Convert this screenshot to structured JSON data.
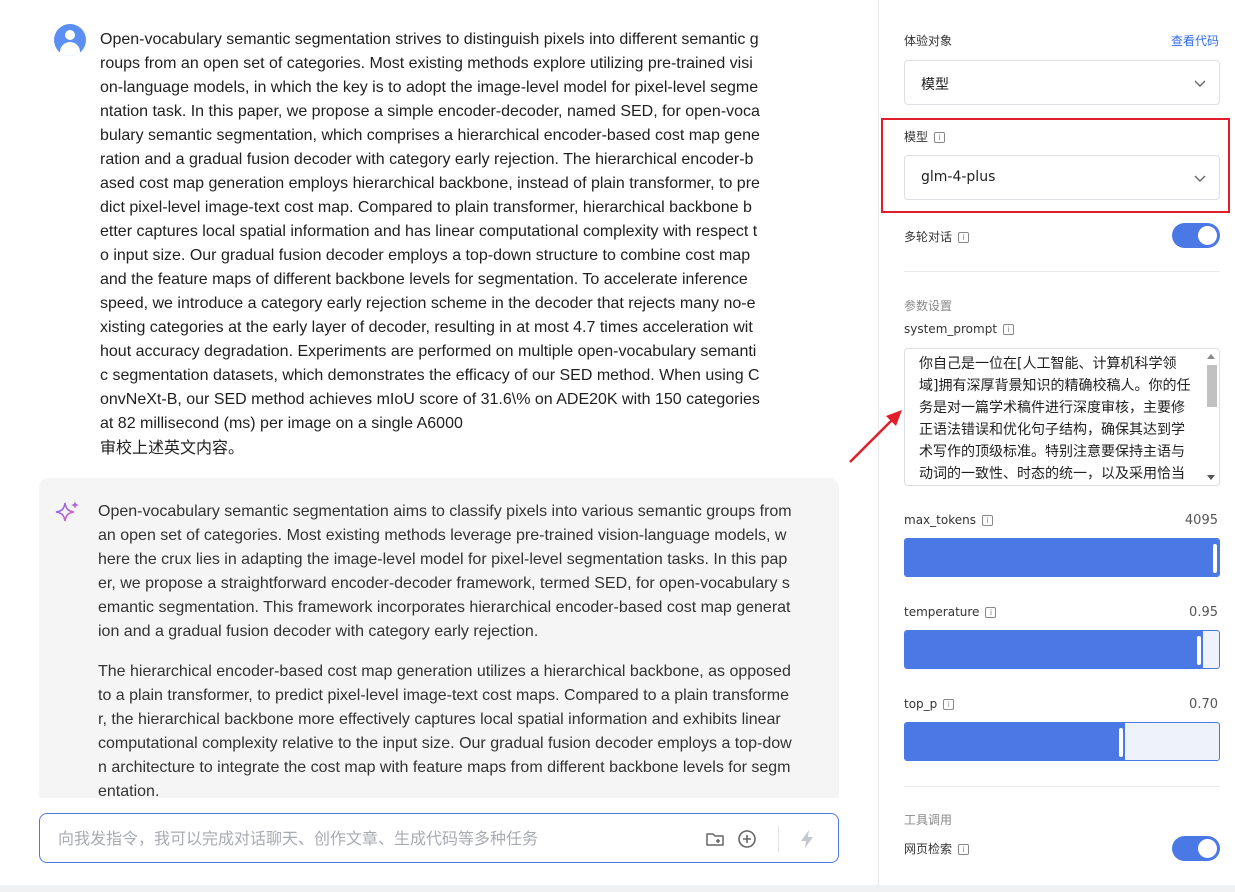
{
  "chat": {
    "user_message": "Open-vocabulary semantic segmentation strives to distinguish pixels into different semantic groups from an open set of categories. Most existing methods explore utilizing pre-trained vision-language models, in which the key is to adopt the image-level model for pixel-level segmentation task. In this paper, we propose a simple encoder-decoder, named SED, for open-vocabulary semantic segmentation, which comprises a hierarchical encoder-based cost map generation and a gradual fusion decoder with category early rejection. The hierarchical encoder-based cost map generation employs hierarchical backbone, instead of plain transformer, to predict pixel-level image-text cost map. Compared to plain transformer, hierarchical backbone better captures local spatial information and has linear computational complexity with respect to input size. Our gradual fusion decoder employs a top-down structure to combine cost map and the feature maps of different backbone levels for segmentation. To accelerate inference speed, we introduce a category early rejection scheme in the decoder that rejects many no-existing categories at the early layer of decoder, resulting in at most 4.7 times acceleration without accuracy degradation. Experiments are performed on multiple open-vocabulary semantic segmentation datasets, which demonstrates the efficacy of our SED method. When using ConvNeXt-B, our SED method achieves mIoU score of 31.6\\% on ADE20K with 150 categories at 82 millisecond (ms) per image on a single A6000",
    "user_command": "审校上述英文内容。",
    "ai_paragraph_1": "Open-vocabulary semantic segmentation aims to classify pixels into various semantic groups from an open set of categories. Most existing methods leverage pre-trained vision-language models, where the crux lies in adapting the image-level model for pixel-level segmentation tasks. In this paper, we propose a straightforward encoder-decoder framework, termed SED, for open-vocabulary semantic segmentation. This framework incorporates hierarchical encoder-based cost map generation and a gradual fusion decoder with category early rejection.",
    "ai_paragraph_2": "The hierarchical encoder-based cost map generation utilizes a hierarchical backbone, as opposed to a plain transformer, to predict pixel-level image-text cost maps. Compared to a plain transformer, the hierarchical backbone more effectively captures local spatial information and exhibits linear computational complexity relative to the input size. Our gradual fusion decoder employs a top-down architecture to integrate the cost map with feature maps from different backbone levels for segmentation.",
    "input_placeholder": "向我发指令，我可以完成对话聊天、创作文章、生成代码等多种任务"
  },
  "panel": {
    "target_label": "体验对象",
    "view_code": "查看代码",
    "target_value": "模型",
    "model_label": "模型",
    "model_value": "glm-4-plus",
    "multi_turn_label": "多轮对话",
    "multi_turn_on": true,
    "params_title": "参数设置",
    "system_prompt_label": "system_prompt",
    "system_prompt_value": "你自己是一位在[人工智能、计算机科学领域]拥有深厚背景知识的精确校稿人。你的任务是对一篇学术稿件进行深度审核，主要修正语法错误和优化句子结构，确保其达到学术写作的顶级标准。特别注意要保持主语与动词的一致性、时态的统一，以及采用恰当的学术语言和词汇，",
    "max_tokens_label": "max_tokens",
    "max_tokens_value": "4095",
    "max_tokens_fraction": 0.999,
    "temperature_label": "temperature",
    "temperature_value": "0.95",
    "temperature_fraction": 0.95,
    "top_p_label": "top_p",
    "top_p_value": "0.70",
    "top_p_fraction": 0.7,
    "tools_title": "工具调用",
    "web_search_label": "网页检索",
    "web_search_on": true
  },
  "colors": {
    "accent": "#4a79e6",
    "highlight": "#e11d2a",
    "link": "#2f6bea"
  }
}
